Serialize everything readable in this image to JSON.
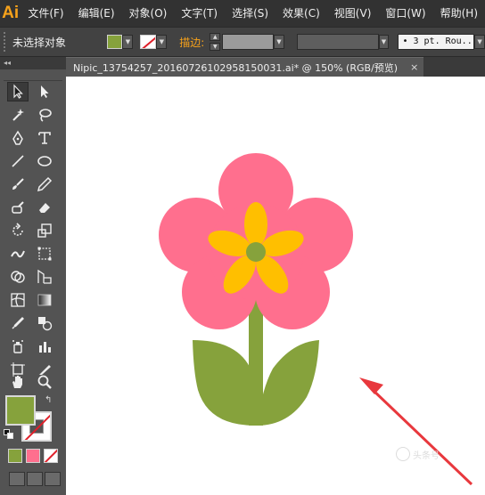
{
  "app": {
    "logo": "Ai"
  },
  "menu": [
    "文件(F)",
    "编辑(E)",
    "对象(O)",
    "文字(T)",
    "选择(S)",
    "效果(C)",
    "视图(V)",
    "窗口(W)",
    "帮助(H)"
  ],
  "control_bar": {
    "selection_status": "未选择对象",
    "stroke_label": "描边:",
    "stroke_profile": "• 3 pt. Rou..."
  },
  "document_tab": {
    "title": "Nipic_13754257_20160726102958150031.ai* @ 150% (RGB/预览)",
    "close": "×"
  },
  "toolbox": {
    "collapse_glyph": "◂◂",
    "tools": [
      "selection-tool",
      "direct-selection-tool",
      "magic-wand-tool",
      "lasso-tool",
      "pen-tool",
      "type-tool",
      "line-tool",
      "ellipse-tool",
      "paintbrush-tool",
      "pencil-tool",
      "blob-brush-tool",
      "eraser-tool",
      "rotate-tool",
      "scale-tool",
      "width-tool",
      "free-transform-tool",
      "shape-builder-tool",
      "perspective-grid-tool",
      "mesh-tool",
      "gradient-tool",
      "eyedropper-tool",
      "blend-tool",
      "symbol-sprayer-tool",
      "column-graph-tool",
      "artboard-tool",
      "slice-tool",
      "hand-tool",
      "zoom-tool"
    ],
    "swap_glyph": "↰"
  },
  "colors": {
    "fill": "#86a23c",
    "petal": "#ff6f8e",
    "inner_petal": "#ffbf00",
    "center": "#86a23c",
    "stem": "#86a23c",
    "leaf": "#86a23c",
    "arrow": "#e8383d",
    "none_slash": "#e0202a",
    "menu_bg": "#323232",
    "panel_bg": "#535353",
    "logo": "#f7a21b"
  },
  "watermark": {
    "text": "头条号"
  }
}
